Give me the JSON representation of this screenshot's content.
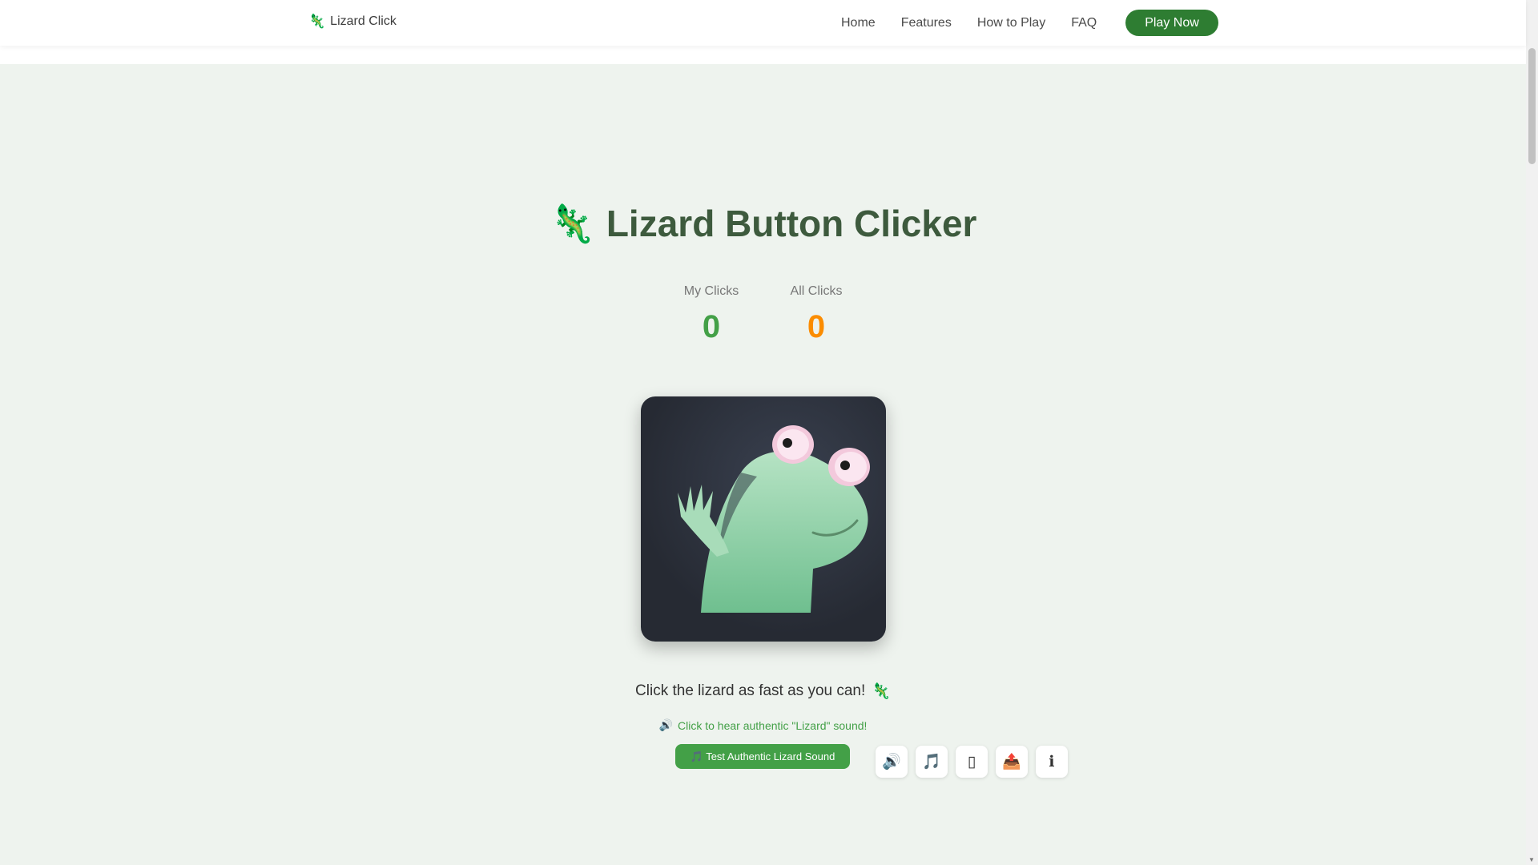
{
  "header": {
    "logo_icon": "🦎",
    "logo_text": "Lizard Click",
    "nav": [
      "Home",
      "Features",
      "How to Play",
      "FAQ"
    ],
    "cta": "Play Now"
  },
  "hero": {
    "title_icon": "🦎",
    "title": "Lizard Button Clicker"
  },
  "stats": {
    "my_label": "My Clicks",
    "my_value": "0",
    "all_label": "All Clicks",
    "all_value": "0"
  },
  "tagline": {
    "text": "Click the lizard as fast as you can!",
    "icon": "🦎"
  },
  "sound": {
    "hint_icon": "🔊",
    "hint_text": "Click to hear authentic \"Lizard\" sound!",
    "test_button": "🎵 Test Authentic Lizard Sound"
  },
  "toolbar": {
    "buttons": [
      {
        "name": "sound-toggle-icon",
        "glyph": "🔊"
      },
      {
        "name": "music-icon",
        "glyph": "🎵"
      },
      {
        "name": "blank-icon",
        "glyph": "▯"
      },
      {
        "name": "share-icon",
        "glyph": "📤"
      },
      {
        "name": "info-icon",
        "glyph": "ℹ"
      }
    ]
  },
  "colors": {
    "brand_green": "#2e7d32",
    "accent_green": "#43a047",
    "accent_orange": "#fb8c00",
    "title_green": "#3d5a3d",
    "background": "#eef3ee"
  }
}
